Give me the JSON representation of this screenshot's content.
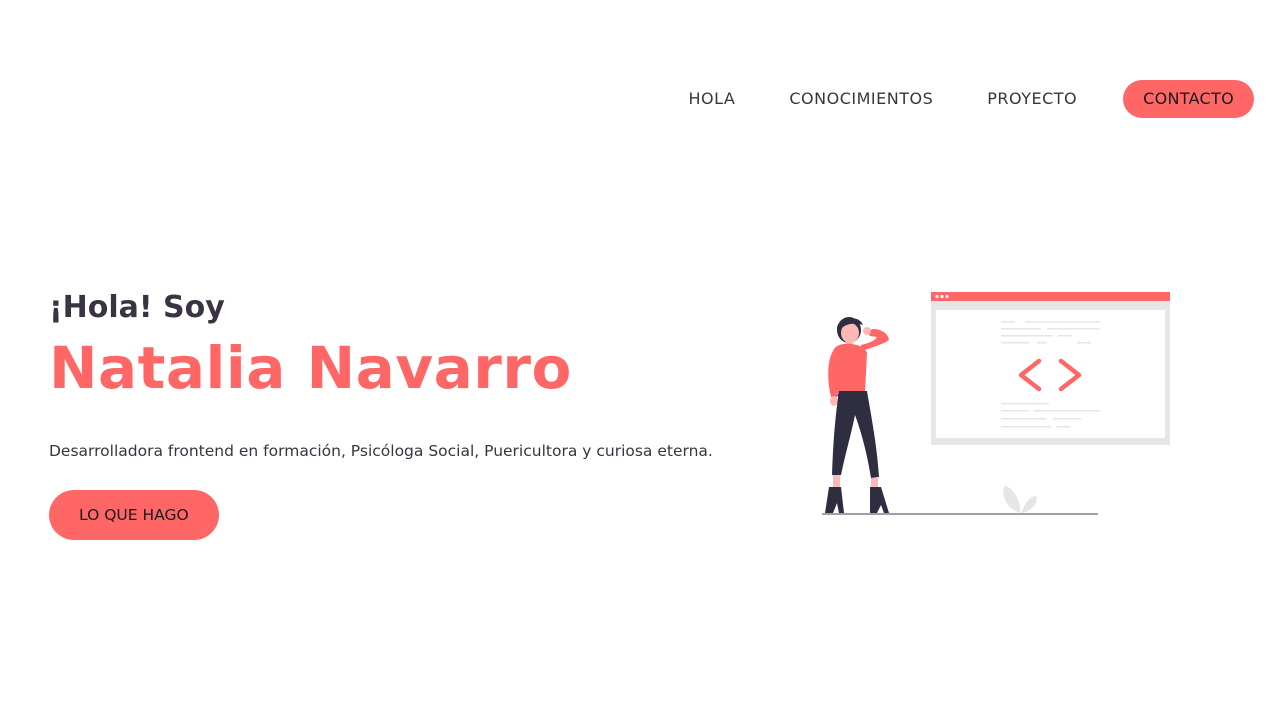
{
  "nav": {
    "items": [
      "HOLA",
      "CONOCIMIENTOS",
      "PROYECTO"
    ],
    "cta_label": "CONTACTO"
  },
  "hero": {
    "greeting": "¡Hola! Soy",
    "name": "Natalia Navarro",
    "tagline": "Desarrolladora frontend en formación, Psicóloga Social, Puericultora y curiosa eterna.",
    "cta_label": "LO QUE HAGO"
  },
  "colors": {
    "accent": "#ff6767",
    "text": "#3a3341",
    "illustration_gray": "#e6e6e6",
    "illustration_dark": "#2f2e41"
  },
  "illustration": {
    "icon": "code-brackets-icon"
  }
}
